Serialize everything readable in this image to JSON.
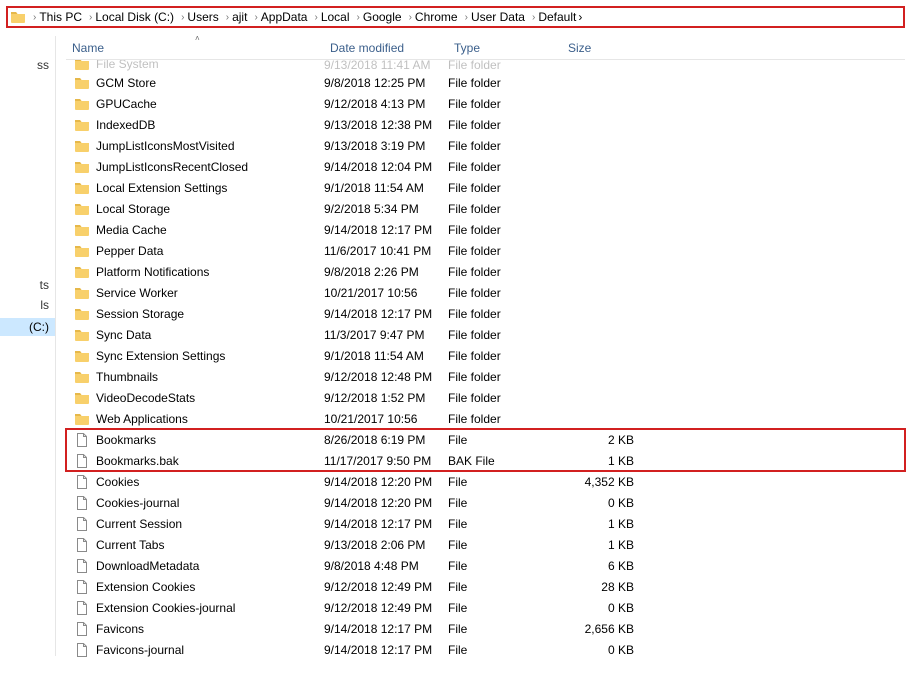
{
  "breadcrumbs": [
    "This PC",
    "Local Disk (C:)",
    "Users",
    "ajit",
    "AppData",
    "Local",
    "Google",
    "Chrome",
    "User Data",
    "Default"
  ],
  "nav": {
    "partial_top": "ss",
    "partial_mid1": "ts",
    "partial_mid2": "ls",
    "current": "(C:)"
  },
  "columns": {
    "name": "Name",
    "date": "Date modified",
    "type": "Type",
    "size": "Size"
  },
  "cutoff": {
    "name": "File System",
    "date": "9/13/2018 11:41 AM",
    "type": "File folder"
  },
  "items": [
    {
      "icon": "folder",
      "name": "GCM Store",
      "date": "9/8/2018 12:25 PM",
      "type": "File folder",
      "size": ""
    },
    {
      "icon": "folder",
      "name": "GPUCache",
      "date": "9/12/2018 4:13 PM",
      "type": "File folder",
      "size": ""
    },
    {
      "icon": "folder",
      "name": "IndexedDB",
      "date": "9/13/2018 12:38 PM",
      "type": "File folder",
      "size": ""
    },
    {
      "icon": "folder",
      "name": "JumpListIconsMostVisited",
      "date": "9/13/2018 3:19 PM",
      "type": "File folder",
      "size": ""
    },
    {
      "icon": "folder",
      "name": "JumpListIconsRecentClosed",
      "date": "9/14/2018 12:04 PM",
      "type": "File folder",
      "size": ""
    },
    {
      "icon": "folder",
      "name": "Local Extension Settings",
      "date": "9/1/2018 11:54 AM",
      "type": "File folder",
      "size": ""
    },
    {
      "icon": "folder",
      "name": "Local Storage",
      "date": "9/2/2018 5:34 PM",
      "type": "File folder",
      "size": ""
    },
    {
      "icon": "folder",
      "name": "Media Cache",
      "date": "9/14/2018 12:17 PM",
      "type": "File folder",
      "size": ""
    },
    {
      "icon": "folder",
      "name": "Pepper Data",
      "date": "11/6/2017 10:41 PM",
      "type": "File folder",
      "size": ""
    },
    {
      "icon": "folder",
      "name": "Platform Notifications",
      "date": "9/8/2018 2:26 PM",
      "type": "File folder",
      "size": ""
    },
    {
      "icon": "folder",
      "name": "Service Worker",
      "date": "10/21/2017 10:56",
      "type": "File folder",
      "size": ""
    },
    {
      "icon": "folder",
      "name": "Session Storage",
      "date": "9/14/2018 12:17 PM",
      "type": "File folder",
      "size": ""
    },
    {
      "icon": "folder",
      "name": "Sync Data",
      "date": "11/3/2017 9:47 PM",
      "type": "File folder",
      "size": ""
    },
    {
      "icon": "folder",
      "name": "Sync Extension Settings",
      "date": "9/1/2018 11:54 AM",
      "type": "File folder",
      "size": ""
    },
    {
      "icon": "folder",
      "name": "Thumbnails",
      "date": "9/12/2018 12:48 PM",
      "type": "File folder",
      "size": ""
    },
    {
      "icon": "folder",
      "name": "VideoDecodeStats",
      "date": "9/12/2018 1:52 PM",
      "type": "File folder",
      "size": ""
    },
    {
      "icon": "folder",
      "name": "Web Applications",
      "date": "10/21/2017 10:56",
      "type": "File folder",
      "size": ""
    },
    {
      "icon": "file",
      "name": "Bookmarks",
      "date": "8/26/2018 6:19 PM",
      "type": "File",
      "size": "2 KB",
      "hl": true
    },
    {
      "icon": "file",
      "name": "Bookmarks.bak",
      "date": "11/17/2017 9:50 PM",
      "type": "BAK File",
      "size": "1 KB",
      "hl": true
    },
    {
      "icon": "file",
      "name": "Cookies",
      "date": "9/14/2018 12:20 PM",
      "type": "File",
      "size": "4,352 KB"
    },
    {
      "icon": "file",
      "name": "Cookies-journal",
      "date": "9/14/2018 12:20 PM",
      "type": "File",
      "size": "0 KB"
    },
    {
      "icon": "file",
      "name": "Current Session",
      "date": "9/14/2018 12:17 PM",
      "type": "File",
      "size": "1 KB"
    },
    {
      "icon": "file",
      "name": "Current Tabs",
      "date": "9/13/2018 2:06 PM",
      "type": "File",
      "size": "1 KB"
    },
    {
      "icon": "file",
      "name": "DownloadMetadata",
      "date": "9/8/2018 4:48 PM",
      "type": "File",
      "size": "6 KB"
    },
    {
      "icon": "file",
      "name": "Extension Cookies",
      "date": "9/12/2018 12:49 PM",
      "type": "File",
      "size": "28 KB"
    },
    {
      "icon": "file",
      "name": "Extension Cookies-journal",
      "date": "9/12/2018 12:49 PM",
      "type": "File",
      "size": "0 KB"
    },
    {
      "icon": "file",
      "name": "Favicons",
      "date": "9/14/2018 12:17 PM",
      "type": "File",
      "size": "2,656 KB"
    },
    {
      "icon": "file",
      "name": "Favicons-journal",
      "date": "9/14/2018 12:17 PM",
      "type": "File",
      "size": "0 KB"
    }
  ]
}
